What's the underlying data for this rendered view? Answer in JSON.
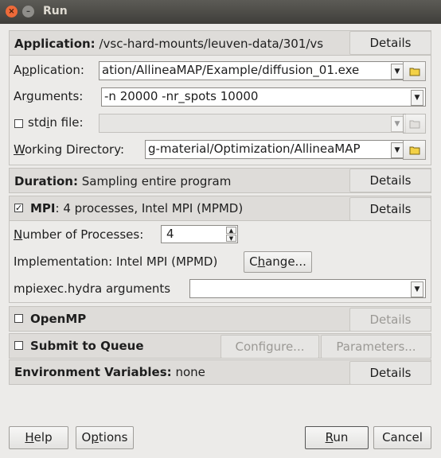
{
  "window": {
    "title": "Run",
    "close_glyph": "×",
    "min_glyph": "–"
  },
  "application": {
    "header_label": "Application:",
    "header_value": "/vsc-hard-mounts/leuven-data/301/vs",
    "details": "Details",
    "app_label_pre": "A",
    "app_label_u": "p",
    "app_label_post": "plication:",
    "app_value": "ation/AllineaMAP/Example/diffusion_01.exe",
    "args_label_pre": "Ar",
    "args_label_u": "g",
    "args_label_post": "uments:",
    "args_value": "-n 20000 -nr_spots 10000",
    "stdin_label_pre": "std",
    "stdin_label_u": "i",
    "stdin_label_post": "n file:",
    "stdin_value": "",
    "wd_label_pre": "",
    "wd_label_u": "W",
    "wd_label_post": "orking Directory:",
    "wd_value": "g-material/Optimization/AllineaMAP"
  },
  "duration": {
    "label": "Duration:",
    "value": "Sampling entire program",
    "details": "Details"
  },
  "mpi": {
    "checked_glyph": "✓",
    "label": "MPI",
    "value": ": 4 processes, Intel MPI (MPMD)",
    "details": "Details",
    "nproc_label_pre": "",
    "nproc_label_u": "N",
    "nproc_label_post": "umber of Processes:",
    "nproc_value": "4",
    "impl_label": "Implementation:",
    "impl_value": "Intel MPI (MPMD)",
    "change_pre": "C",
    "change_u": "h",
    "change_post": "ange...",
    "mpiexec_label": "mpiexec.hydra arguments",
    "mpiexec_value": ""
  },
  "openmp": {
    "label": "OpenMP",
    "details": "Details"
  },
  "queue": {
    "label": "Submit to Queue",
    "configure": "Configure...",
    "parameters": "Parameters..."
  },
  "env": {
    "label": "Environment Variables:",
    "value": "none",
    "details": "Details"
  },
  "footer": {
    "help_u": "H",
    "help_post": "elp",
    "options_pre": "O",
    "options_u": "p",
    "options_post": "tions",
    "run_u": "R",
    "run_post": "un",
    "cancel": "Cancel"
  }
}
